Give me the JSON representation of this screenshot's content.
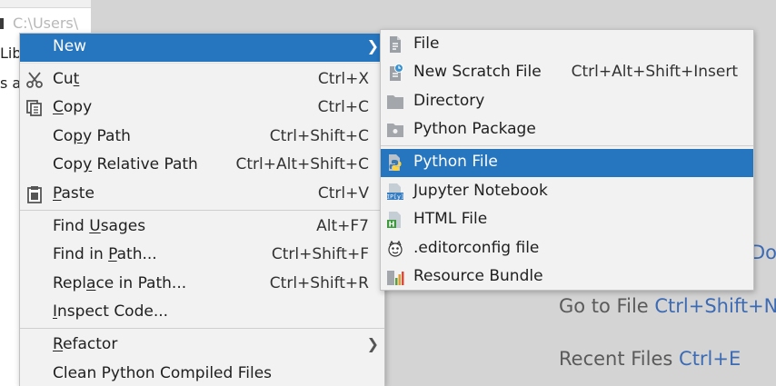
{
  "background": {
    "path_label": "C:\\Users\\",
    "tree_fragments": [
      "Lib",
      "s a"
    ],
    "hints": [
      {
        "label": "",
        "key": "Do"
      },
      {
        "label": "Go to File",
        "key": "Ctrl+Shift+N"
      },
      {
        "label": "Recent Files",
        "key": "Ctrl+E"
      }
    ]
  },
  "context_menu": {
    "new": {
      "label": "New"
    },
    "cut": {
      "pre": "Cu",
      "u": "t",
      "post": "",
      "shortcut": "Ctrl+X"
    },
    "copy": {
      "pre": "",
      "u": "C",
      "post": "opy",
      "shortcut": "Ctrl+C"
    },
    "copy_path": {
      "pre": "Co",
      "u": "p",
      "post": "y Path",
      "shortcut": "Ctrl+Shift+C"
    },
    "copy_relative_path": {
      "pre": "Cop",
      "u": "y",
      "post": " Relative Path",
      "shortcut": "Ctrl+Alt+Shift+C"
    },
    "paste": {
      "pre": "",
      "u": "P",
      "post": "aste",
      "shortcut": "Ctrl+V"
    },
    "find_usages": {
      "pre": "Find ",
      "u": "U",
      "post": "sages",
      "shortcut": "Alt+F7"
    },
    "find_in_path": {
      "pre": "Find in ",
      "u": "P",
      "post": "ath...",
      "shortcut": "Ctrl+Shift+F"
    },
    "replace_in_path": {
      "pre": "Repl",
      "u": "a",
      "post": "ce in Path...",
      "shortcut": "Ctrl+Shift+R"
    },
    "inspect_code": {
      "pre": "",
      "u": "I",
      "post": "nspect Code..."
    },
    "refactor": {
      "pre": "",
      "u": "R",
      "post": "efactor"
    },
    "clean_compiled": {
      "label": "Clean Python Compiled Files"
    }
  },
  "submenu": {
    "file": {
      "label": "File"
    },
    "new_scratch_file": {
      "label": "New Scratch File",
      "shortcut": "Ctrl+Alt+Shift+Insert"
    },
    "directory": {
      "label": "Directory"
    },
    "python_package": {
      "label": "Python Package"
    },
    "python_file": {
      "label": "Python File"
    },
    "jupyter_notebook": {
      "label": "Jupyter Notebook"
    },
    "html_file": {
      "label": "HTML File"
    },
    "editorconfig_file": {
      "label": ".editorconfig file"
    },
    "resource_bundle": {
      "label": "Resource Bundle"
    }
  },
  "colors": {
    "selection": "#2675bf",
    "menu_bg": "#f2f2f2",
    "shortcut_link": "#3d6bb3"
  },
  "icons": {
    "cut": "scissors-icon",
    "copy": "copy-icon",
    "paste": "clipboard-icon",
    "file": "file-icon",
    "scratch": "scratch-file-icon",
    "directory": "folder-icon",
    "package": "python-package-icon",
    "python_file": "python-logo-icon",
    "jupyter": "jupyter-icon",
    "html": "html-icon",
    "editorconfig": "editorconfig-icon",
    "resource_bundle": "resource-bundle-icon"
  }
}
